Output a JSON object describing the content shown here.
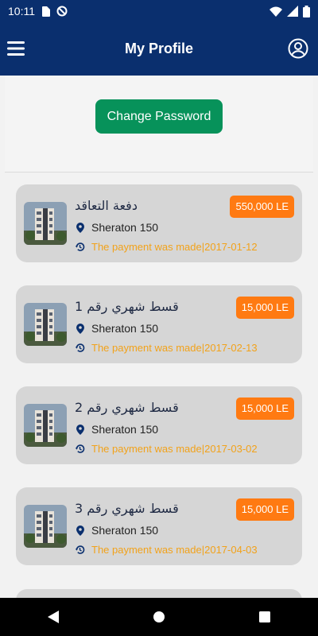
{
  "status_bar": {
    "time": "10:11"
  },
  "header": {
    "title": "My Profile"
  },
  "actions": {
    "change_password_label": "Change Password"
  },
  "payments": [
    {
      "title": "دفعة التعاقد",
      "amount": "550,000 LE",
      "location": "Sheraton 150",
      "status": "The payment was made|2017-01-12"
    },
    {
      "title": "قسط شهري رقم 1",
      "amount": "15,000 LE",
      "location": "Sheraton 150",
      "status": "The payment was made|2017-02-13"
    },
    {
      "title": "قسط شهري رقم 2",
      "amount": "15,000 LE",
      "location": "Sheraton 150",
      "status": "The payment was made|2017-03-02"
    },
    {
      "title": "قسط شهري رقم 3",
      "amount": "15,000 LE",
      "location": "Sheraton 150",
      "status": "The payment was made|2017-04-03"
    }
  ],
  "colors": {
    "primary": "#0a2f6e",
    "accent_green": "#07925a",
    "price_orange": "#ff7a12",
    "status_orange": "#f2a21a",
    "card_bg": "#d6d6d6"
  },
  "icons": {
    "menu": "hamburger-icon",
    "profile": "account-circle-icon",
    "location": "map-pin-icon",
    "status": "history-icon",
    "nav_back": "triangle-back-icon",
    "nav_home": "circle-home-icon",
    "nav_recent": "square-recent-icon"
  }
}
